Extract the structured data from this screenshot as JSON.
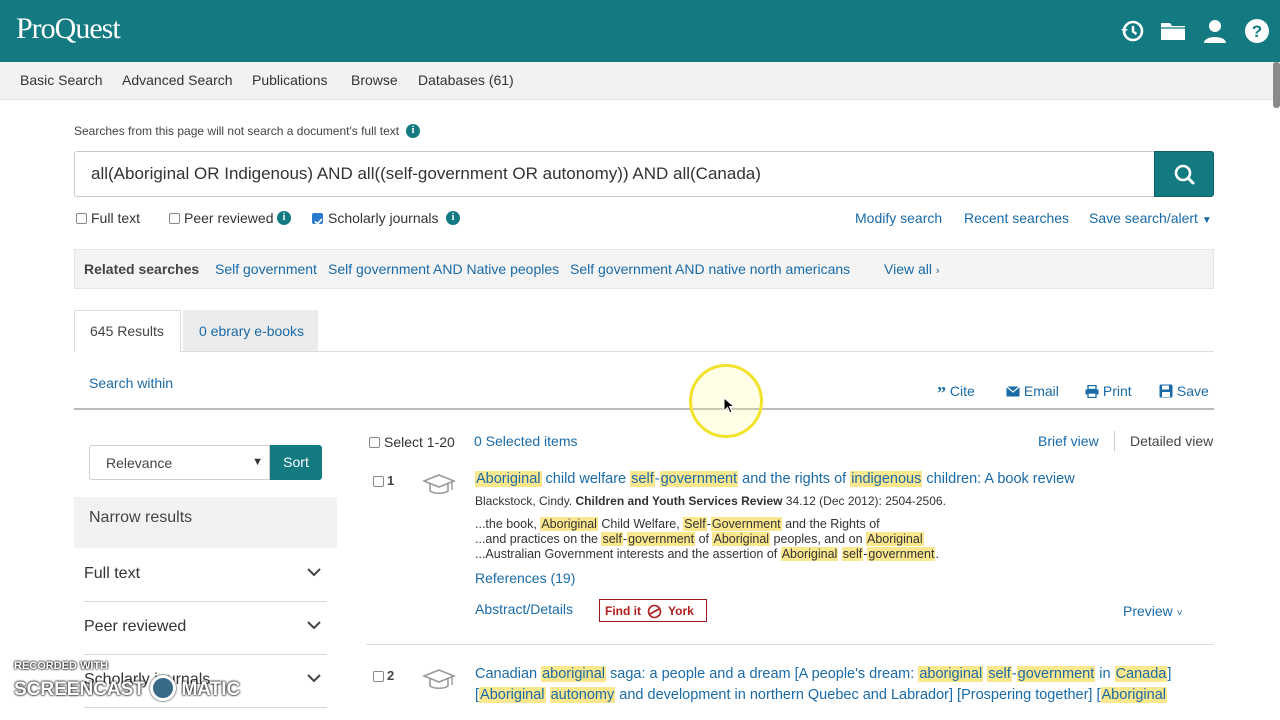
{
  "app": {
    "logo": "ProQuest"
  },
  "nav": [
    "Basic Search",
    "Advanced Search",
    "Publications",
    "Browse",
    "Databases (61)"
  ],
  "search": {
    "note": "Searches from this page will not search a document's full text",
    "query": "all(Aboriginal OR Indigenous) AND all((self-government OR autonomy)) AND all(Canada)"
  },
  "filters": {
    "full_text": "Full text",
    "peer_reviewed": "Peer reviewed",
    "scholarly": "Scholarly journals"
  },
  "search_actions": {
    "modify": "Modify search",
    "recent": "Recent searches",
    "save": "Save search/alert"
  },
  "related": {
    "label": "Related searches",
    "items": [
      "Self government",
      "Self government AND Native peoples",
      "Self government AND native north americans"
    ],
    "view_all": "View all"
  },
  "tabs": {
    "results": "645 Results",
    "ebooks": "0 ebrary e-books"
  },
  "search_within": "Search within",
  "tools": {
    "cite": "Cite",
    "email": "Email",
    "print": "Print",
    "save": "Save"
  },
  "sort": {
    "selected": "Relevance",
    "button": "Sort"
  },
  "list_controls": {
    "select_range": "Select 1-20",
    "selected": "0 Selected items",
    "brief": "Brief view",
    "detailed": "Detailed view"
  },
  "narrow": {
    "heading": "Narrow results",
    "facets": [
      "Full text",
      "Peer reviewed",
      "Scholarly journals"
    ]
  },
  "results": [
    {
      "num": "1",
      "title_parts": [
        {
          "t": "Aboriginal",
          "h": true
        },
        {
          "t": " child welfare ",
          "h": false
        },
        {
          "t": "self",
          "h": true
        },
        {
          "t": "-",
          "h": false
        },
        {
          "t": "government",
          "h": true
        },
        {
          "t": " and the rights of ",
          "h": false
        },
        {
          "t": "indigenous",
          "h": true
        },
        {
          "t": " children: A book review",
          "h": false
        }
      ],
      "author": "Blackstock, Cindy.",
      "journal": "Children and Youth Services Review",
      "citation": "34.12  (Dec 2012): 2504-2506.",
      "snippets": [
        [
          {
            "t": "...the book, ",
            "h": false
          },
          {
            "t": "Aboriginal",
            "h": true
          },
          {
            "t": " Child Welfare, ",
            "h": false
          },
          {
            "t": "Self",
            "h": true
          },
          {
            "t": "-",
            "h": false
          },
          {
            "t": "Government",
            "h": true
          },
          {
            "t": " and the Rights of",
            "h": false
          }
        ],
        [
          {
            "t": "...and practices on the ",
            "h": false
          },
          {
            "t": "self",
            "h": true
          },
          {
            "t": "-",
            "h": false
          },
          {
            "t": "government",
            "h": true
          },
          {
            "t": " of ",
            "h": false
          },
          {
            "t": "Aboriginal",
            "h": true
          },
          {
            "t": " peoples, and on ",
            "h": false
          },
          {
            "t": "Aboriginal",
            "h": true
          }
        ],
        [
          {
            "t": "...Australian Government interests and the assertion of ",
            "h": false
          },
          {
            "t": "Aboriginal",
            "h": true
          },
          {
            "t": " ",
            "h": false
          },
          {
            "t": "self",
            "h": true
          },
          {
            "t": "-",
            "h": false
          },
          {
            "t": "government",
            "h": true
          },
          {
            "t": ".",
            "h": false
          }
        ]
      ],
      "references": "References (19)",
      "abstract": "Abstract/Details",
      "findit": "Find it",
      "findit_inst": "York",
      "preview": "Preview"
    },
    {
      "num": "2",
      "title_lines": [
        [
          {
            "t": "Canadian ",
            "h": false
          },
          {
            "t": "aboriginal",
            "h": true
          },
          {
            "t": " saga: a people and a dream [A people's dream: ",
            "h": false
          },
          {
            "t": "aboriginal",
            "h": true
          },
          {
            "t": " ",
            "h": false
          },
          {
            "t": "self",
            "h": true
          },
          {
            "t": "-",
            "h": false
          },
          {
            "t": "government",
            "h": true
          },
          {
            "t": " in ",
            "h": false
          },
          {
            "t": "Canada",
            "h": true
          },
          {
            "t": "]",
            "h": false
          }
        ],
        [
          {
            "t": "[",
            "h": false
          },
          {
            "t": "Aboriginal",
            "h": true
          },
          {
            "t": " ",
            "h": false
          },
          {
            "t": "autonomy",
            "h": true
          },
          {
            "t": " and development in northern Quebec and Labrador] [Prospering together] [",
            "h": false
          },
          {
            "t": "Aboriginal",
            "h": true
          }
        ]
      ]
    }
  ],
  "watermark": {
    "line1": "RECORDED WITH",
    "line2": "SCREENCAST",
    "line3": "MATIC"
  }
}
